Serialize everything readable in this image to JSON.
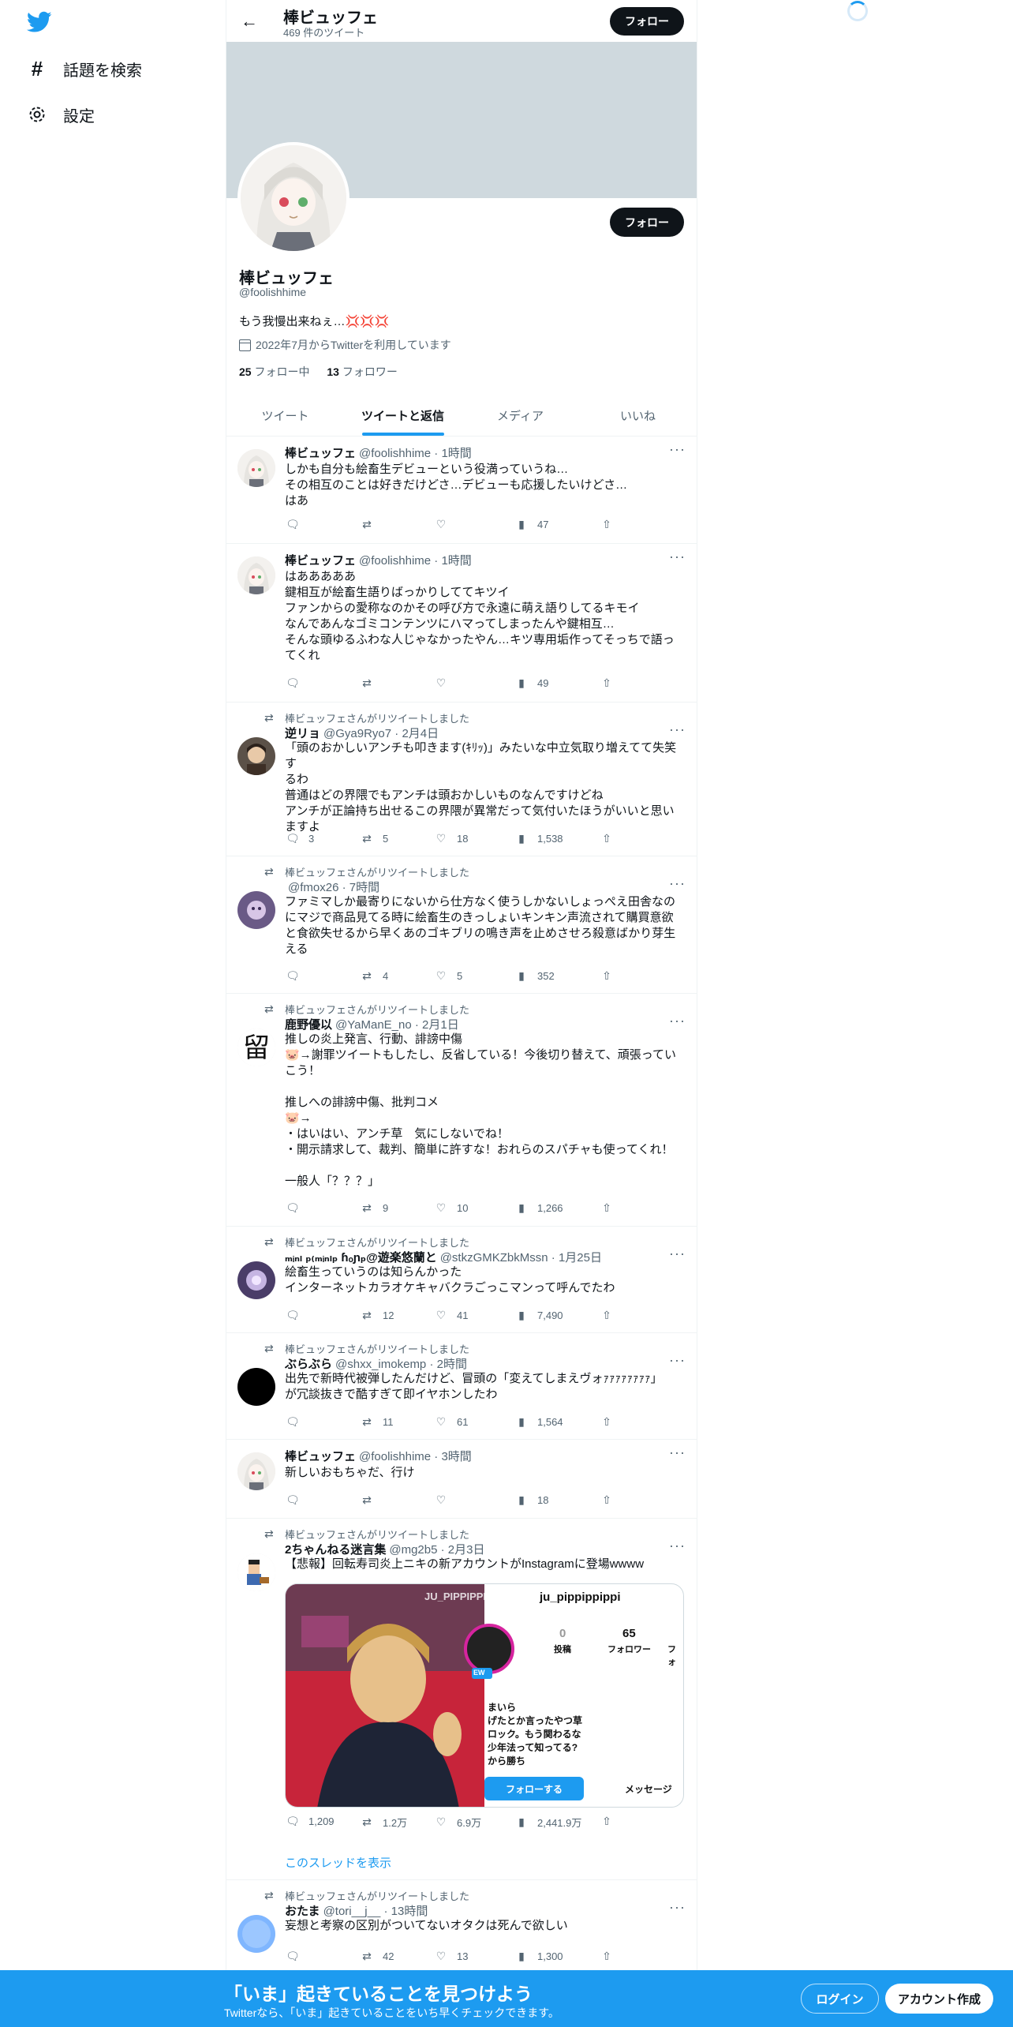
{
  "nav": {
    "items": [
      {
        "label": "話題を検索",
        "icon": "hashtag-icon"
      },
      {
        "label": "設定",
        "icon": "gear-icon"
      }
    ]
  },
  "header": {
    "name": "棒ビュッフェ",
    "tweet_count": "469 件のツイート",
    "follow_label": "フォロー"
  },
  "profile": {
    "name": "棒ビュッフェ",
    "handle": "@foolishhime",
    "bio": "もう我慢出来ねぇ…💢💢💢",
    "joined": "2022年7月からTwitterを利用しています",
    "following_count": "25",
    "following_label": "フォロー中",
    "followers_count": "13",
    "followers_label": "フォロワー",
    "follow_label": "フォロー"
  },
  "tabs": [
    {
      "label": "ツイート",
      "active": false
    },
    {
      "label": "ツイートと返信",
      "active": true
    },
    {
      "label": "メディア",
      "active": false
    },
    {
      "label": "いいね",
      "active": false
    }
  ],
  "tweets": [
    {
      "retweeted_by": "",
      "name": "棒ビュッフェ",
      "handle_time": "@foolishhime · 1時間",
      "text": "しかも自分も絵畜生デビューという役満っていうね…\nその相互のことは好きだけどさ…デビューも応援したいけどさ…\nはあ",
      "replies": "",
      "retweets": "",
      "likes": "",
      "views": "47"
    },
    {
      "retweeted_by": "",
      "name": "棒ビュッフェ",
      "handle_time": "@foolishhime · 1時間",
      "text": "はあああああ\n鍵相互が絵畜生語りばっかりしててキツイ\nファンからの愛称なのかその呼び方で永遠に萌え語りしてるキモイ\nなんであんなゴミコンテンツにハマってしまったんや鍵相互…\nそんな頭ゆるふわな人じゃなかったやん…キツ専用垢作ってそっちで語っ\nてくれ",
      "replies": "",
      "retweets": "",
      "likes": "",
      "views": "49"
    },
    {
      "retweeted_by": "棒ビュッフェさんがリツイートしました",
      "name": "逆リョ",
      "handle_time": "@Gya9Ryo7 · 2月4日",
      "text": "「頭のおかしいアンチも叩きます(ｷﾘｯ)」みたいな中立気取り増えてて失笑す\nるわ\n普通はどの界隈でもアンチは頭おかしいものなんですけどね\nアンチが正論持ち出せるこの界隈が異常だって気付いたほうがいいと思い\nますよ",
      "replies": "3",
      "retweets": "5",
      "likes": "18",
      "views": "1,538"
    },
    {
      "retweeted_by": "棒ビュッフェさんがリツイートしました",
      "name": "",
      "handle_time": "@fmox26 · 7時間",
      "text": "ファミマしか最寄りにないから仕方なく使うしかないしょっぺえ田舎なの\nにマジで商品見てる時に絵畜生のきっしょいキンキン声流されて購買意欲\nと食欲失せるから早くあのゴキブリの鳴き声を止めさせろ殺意ばかり芽生\nえる",
      "replies": "",
      "retweets": "4",
      "likes": "5",
      "views": "352"
    },
    {
      "retweeted_by": "棒ビュッフェさんがリツイートしました",
      "name": "鹿野優以",
      "handle_time": "@YaManE_no · 2月1日",
      "text": "推しの炎上発言、行動、誹謗中傷\n🐷→謝罪ツイートもしたし、反省している！今後切り替えて、頑張ってい\nこう！\n\n推しへの誹謗中傷、批判コメ\n🐷→\n・はいはい、アンチ草　気にしないでね！\n・開示請求して、裁判、簡単に許すな！おれらのスパチャも使ってくれ！\n\n一般人「？？？」",
      "replies": "",
      "retweets": "9",
      "likes": "10",
      "views": "1,266"
    },
    {
      "retweeted_by": "棒ビュッフェさんがリツイートしました",
      "name": "ₘᵢₙₗ ₚ₍ₘᵢₙₗₚ ɦₒɲₚ@遊楽悠蘭と",
      "handle_time": "@stkzGMKZbkMssn · 1月25日",
      "text": "絵畜生っていうのは知らんかった\nインターネットカラオケキャバクラごっこマンって呼んでたわ",
      "replies": "",
      "retweets": "12",
      "likes": "41",
      "views": "7,490"
    },
    {
      "retweeted_by": "棒ビュッフェさんがリツイートしました",
      "name": "ぶらぶら",
      "handle_time": "@shxx_imokemp · 2時間",
      "text": "出先で新時代被弾したんだけど、冒頭の「変えてしまえヴォｧｧｧｧｧｧｧｧ」\nが冗談抜きで酷すぎて即イヤホンしたわ",
      "replies": "",
      "retweets": "11",
      "likes": "61",
      "views": "1,564"
    },
    {
      "retweeted_by": "",
      "name": "棒ビュッフェ",
      "handle_time": "@foolishhime · 3時間",
      "text": "新しいおもちゃだ、行け",
      "replies": "",
      "retweets": "",
      "likes": "",
      "views": "18"
    },
    {
      "retweeted_by": "棒ビュッフェさんがリツイートしました",
      "name": "2ちゃんねる迷言集",
      "handle_time": "@mg2b5 · 2月3日",
      "text": "【悲報】回転寿司炎上ニキの新アカウントがInstagramに登場wwww",
      "replies": "1,209",
      "retweets": "1.2万",
      "likes": "6.9万",
      "views": "2,441.9万",
      "media": {
        "overlay_text": "JU_PIPPIPPI",
        "username": "ju_pippippippi",
        "posts_count": "0",
        "posts_label": "投稿",
        "followers_count": "65",
        "followers_label": "フォロワー",
        "following_label": "フォ",
        "new_badge": "EW",
        "bio": "まいら\nげたとか言ったやつ草\nロック。もう関わるな\n少年法って知ってる?\nから勝ち",
        "follow_btn": "フォローする",
        "message_btn": "メッセージ"
      },
      "thread_label": "このスレッドを表示"
    },
    {
      "retweeted_by": "棒ビュッフェさんがリツイートしました",
      "name": "おたま",
      "handle_time": "@tori__j__ · 13時間",
      "text": "妄想と考察の区別がついてないオタクは死んで欲しい",
      "replies": "",
      "retweets": "42",
      "likes": "13",
      "views": "1,300"
    }
  ],
  "bottom_bar": {
    "title": "「いま」起きていることを見つけよう",
    "subtitle": "Twitterなら、「いま」起きていることをいち早くチェックできます。",
    "login": "ログイン",
    "signup": "アカウント作成"
  },
  "colors": {
    "brand": "#1d9bf0",
    "text": "#0f1419",
    "muted": "#536471",
    "banner": "#cfd9de"
  }
}
